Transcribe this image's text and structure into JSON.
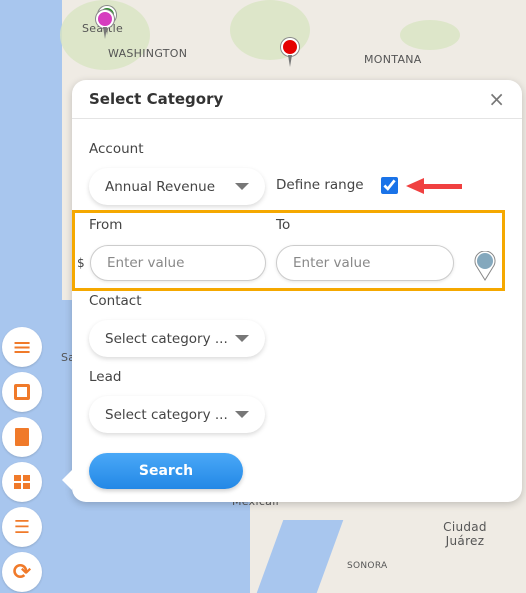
{
  "map": {
    "labels": [
      "Seattle",
      "WASHINGTON",
      "MONTANA",
      "Sa",
      "Mexicali",
      "Ciudad Juárez",
      "SONORA"
    ],
    "pins": [
      {
        "color": "#2e8b2e"
      },
      {
        "color": "#d63dbf"
      },
      {
        "color": "#e50000"
      }
    ]
  },
  "sidebar": {
    "items": [
      {
        "icon": "menu-icon",
        "glyph": "≡"
      },
      {
        "icon": "save-icon",
        "glyph": "💾"
      },
      {
        "icon": "document-icon",
        "glyph": "▤"
      },
      {
        "icon": "grid-icon",
        "glyph": "▦"
      },
      {
        "icon": "numbered-list-icon",
        "glyph": "☰"
      },
      {
        "icon": "refresh-icon",
        "glyph": "⟳"
      }
    ],
    "accent": "#f07a2a"
  },
  "dialog": {
    "title": "Select Category",
    "close": "×",
    "account": {
      "label": "Account",
      "selected": "Annual Revenue",
      "define_range_label": "Define range",
      "define_range_checked": true
    },
    "range": {
      "from_label": "From",
      "to_label": "To",
      "currency": "$",
      "from_placeholder": "Enter value",
      "to_placeholder": "Enter value",
      "highlight_color": "#f5a800"
    },
    "contact": {
      "label": "Contact",
      "selected": "Select category ..."
    },
    "lead": {
      "label": "Lead",
      "selected": "Select category ..."
    },
    "search_label": "Search"
  },
  "annotation": {
    "arrow_color": "#f04040"
  }
}
